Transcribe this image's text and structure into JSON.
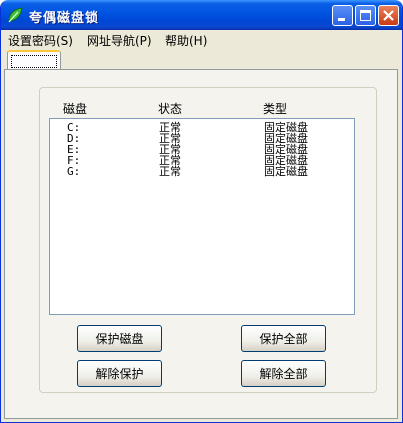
{
  "window": {
    "title": "夸偶磁盘锁"
  },
  "menu": [
    {
      "label": "设置密码(S)"
    },
    {
      "label": "网址导航(P)"
    },
    {
      "label": "帮助(H)"
    }
  ],
  "tabs": [
    {
      "label": ""
    }
  ],
  "list": {
    "columns": [
      "磁盘",
      "状态",
      "类型"
    ],
    "rows": [
      {
        "drive": "C:",
        "status": "正常",
        "type": "固定磁盘"
      },
      {
        "drive": "D:",
        "status": "正常",
        "type": "固定磁盘"
      },
      {
        "drive": "E:",
        "status": "正常",
        "type": "固定磁盘"
      },
      {
        "drive": "F:",
        "status": "正常",
        "type": "固定磁盘"
      },
      {
        "drive": "G:",
        "status": "正常",
        "type": "固定磁盘"
      }
    ]
  },
  "buttons": {
    "protect_disk": "保护磁盘",
    "protect_all": "保护全部",
    "unprotect": "解除保护",
    "unprotect_all": "解除全部"
  },
  "colors": {
    "titlebar": "#0054e3",
    "close_button": "#d9532c",
    "tab_highlight": "#ffc83c"
  },
  "icons": [
    "leaf-icon",
    "minimize-icon",
    "maximize-icon",
    "close-icon"
  ]
}
